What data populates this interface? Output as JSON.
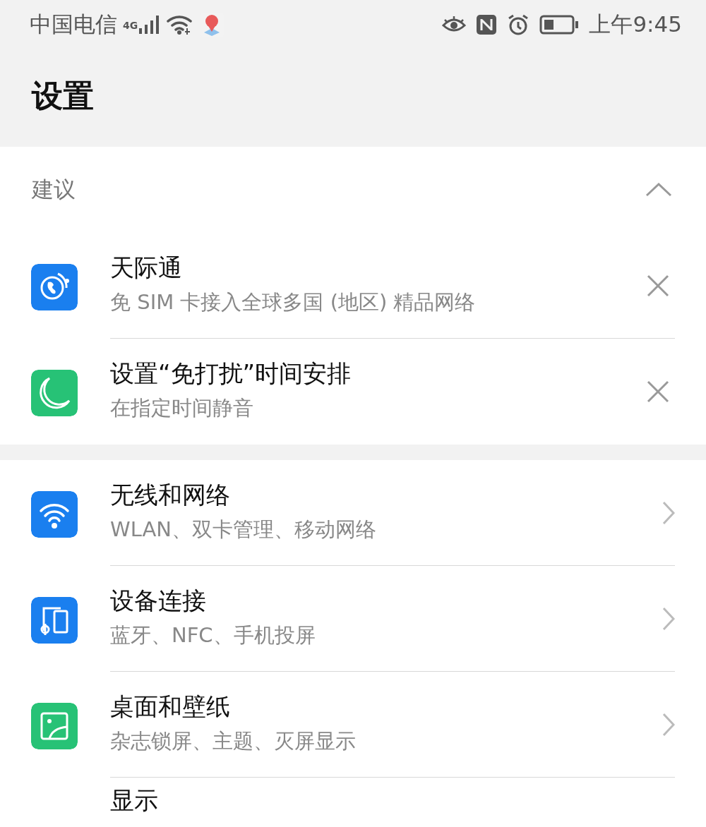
{
  "status_bar": {
    "carrier": "中国电信",
    "network_type": "4G",
    "time": "上午9:45"
  },
  "header": {
    "title": "设置"
  },
  "suggestions": {
    "title": "建议",
    "expanded": true,
    "items": [
      {
        "kind": "suggestion",
        "title": "天际通",
        "subtitle": "免 SIM 卡接入全球多国 (地区) 精品网络"
      },
      {
        "kind": "suggestion",
        "title": "设置“免打扰”时间安排",
        "subtitle": "在指定时间静音"
      }
    ]
  },
  "settings": [
    {
      "kind": "link",
      "title": "无线和网络",
      "subtitle": "WLAN、双卡管理、移动网络"
    },
    {
      "kind": "link",
      "title": "设备连接",
      "subtitle": "蓝牙、NFC、手机投屏"
    },
    {
      "kind": "link",
      "title": "桌面和壁纸",
      "subtitle": "杂志锁屏、主题、灭屏显示"
    },
    {
      "title": "显示"
    }
  ]
}
